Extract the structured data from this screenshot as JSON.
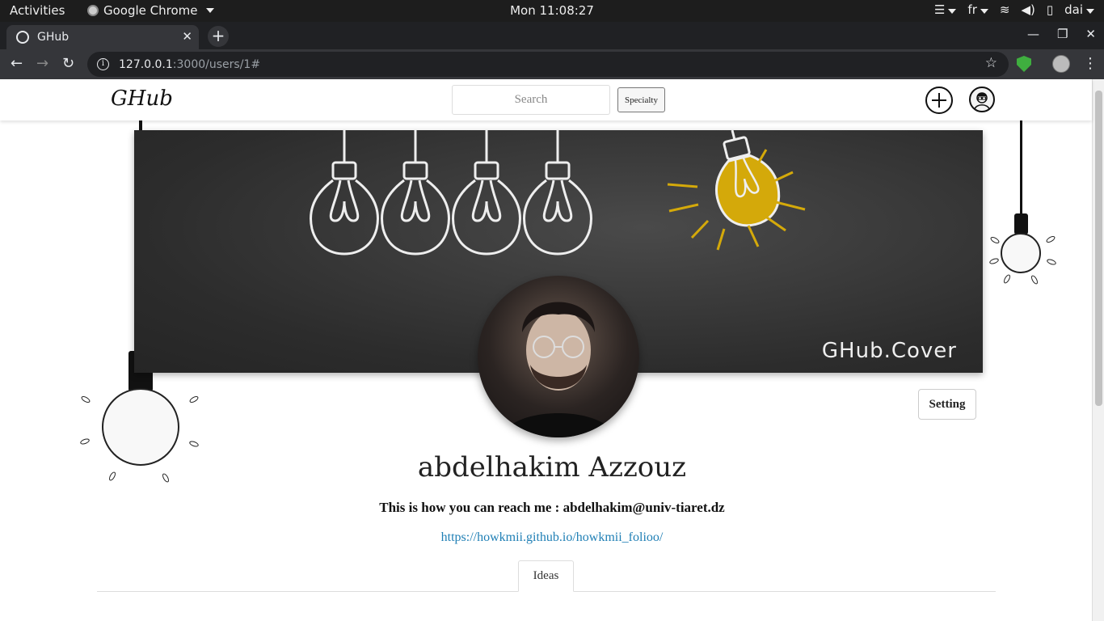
{
  "topbar": {
    "activities": "Activities",
    "app_name": "Google Chrome",
    "clock": "Mon 11:08:27",
    "language": "fr",
    "user": "dai"
  },
  "browser": {
    "tab_title": "GHub",
    "url_host": "127.0.0.1",
    "url_path": ":3000/users/1#"
  },
  "site": {
    "brand": "GHub",
    "search_placeholder": "Search",
    "specialty_label": "Specialty"
  },
  "profile": {
    "cover_tag": "GHub.Cover",
    "setting_label": "Setting",
    "name": "abdelhakim Azzouz",
    "contact": "This is how you can reach me : abdelhakim@univ-tiaret.dz",
    "link": "https://howkmii.github.io/howkmii_folioo/",
    "tabs": [
      "Ideas"
    ]
  },
  "colors": {
    "bulb_lit": "#d4a90a",
    "link": "#1f7fb5",
    "cover_bg": "#333333"
  }
}
